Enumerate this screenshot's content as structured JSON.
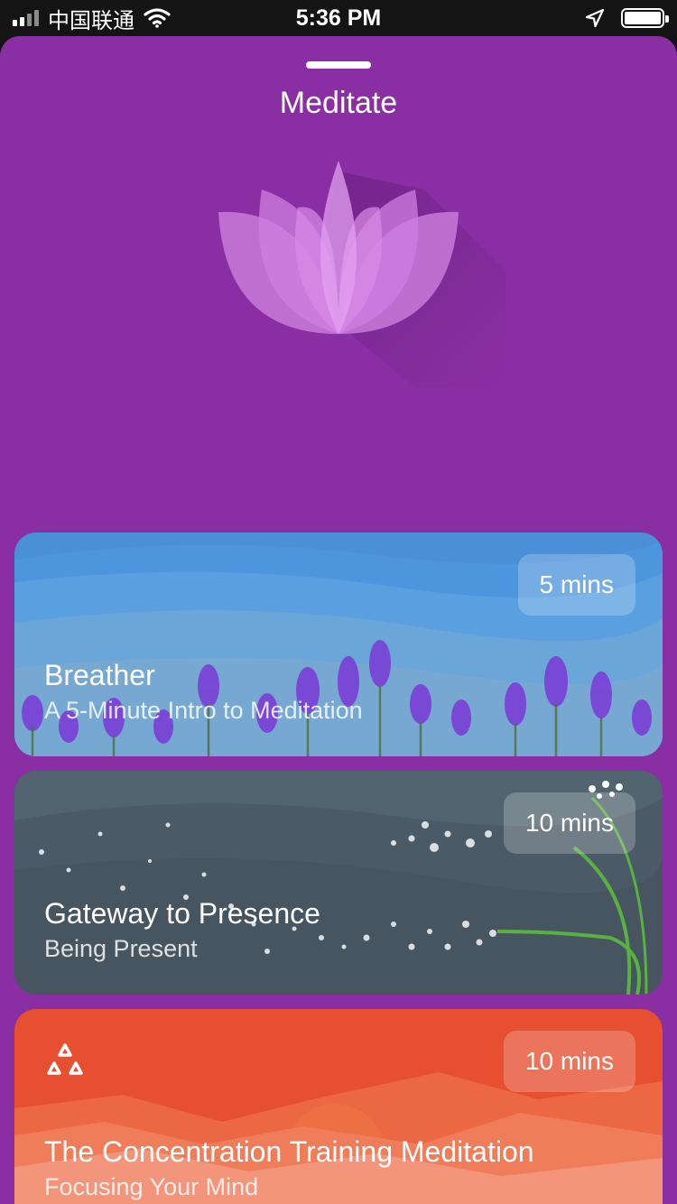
{
  "status_bar": {
    "carrier": "中国联通",
    "time": "5:36 PM",
    "battery_level": 1.0
  },
  "sheet": {
    "title": "Meditate",
    "hero_icon": "lotus-icon",
    "background_color": "#8a2fa3"
  },
  "cards": [
    {
      "title": "Breather",
      "subtitle": "A 5-Minute Intro to Meditation",
      "duration": "5 mins",
      "theme": "lavender-field",
      "color": "#4a90d9"
    },
    {
      "title": "Gateway to Presence",
      "subtitle": "Being Present",
      "duration": "10 mins",
      "theme": "dandelion",
      "color": "#475864"
    },
    {
      "title": "The Concentration Training Meditation",
      "subtitle": "Focusing Your Mind",
      "duration": "10 mins",
      "theme": "sunset-mountains",
      "color": "#e64f2f",
      "logo": "triangle-circles-icon"
    }
  ]
}
